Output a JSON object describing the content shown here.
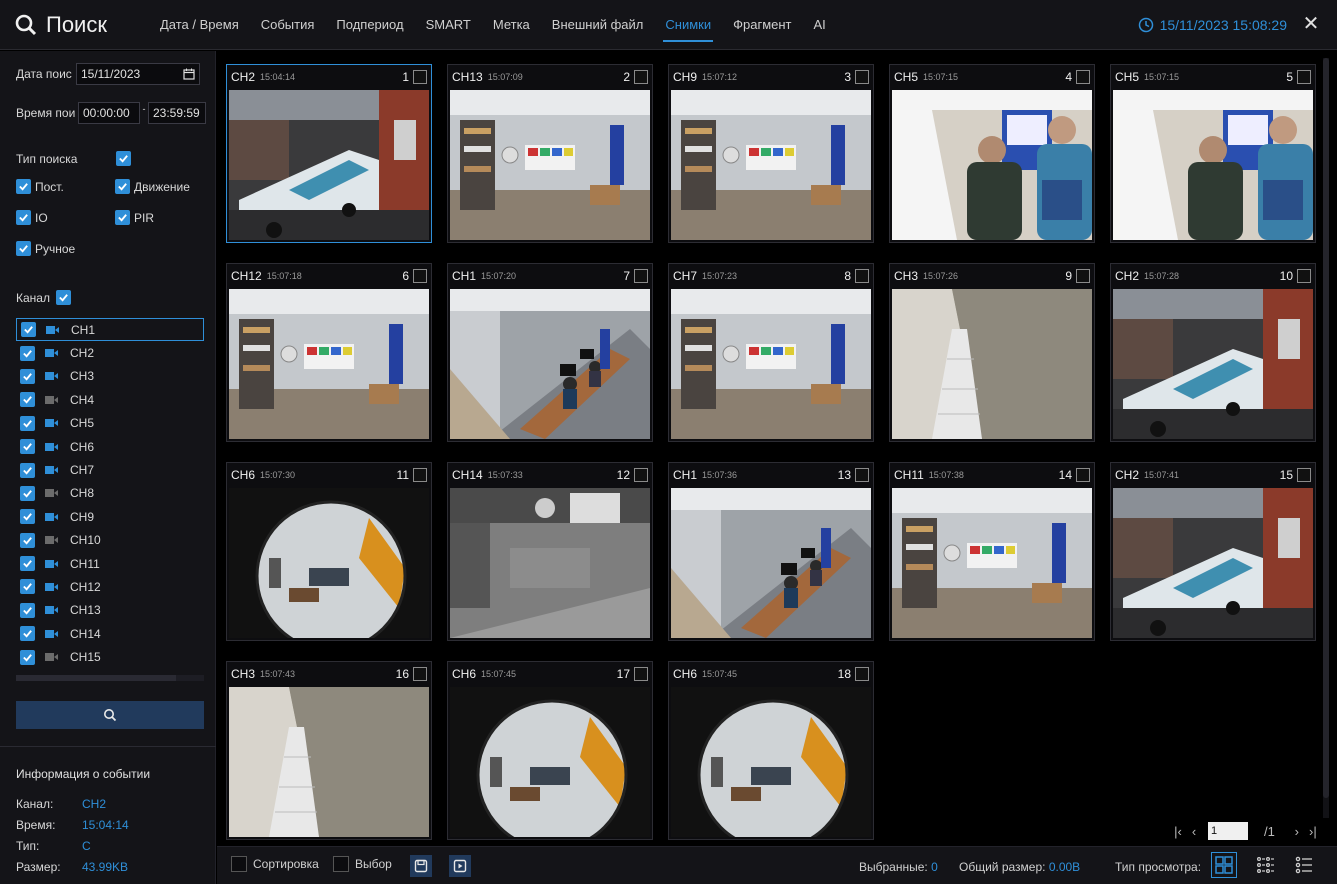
{
  "header": {
    "title": "Поиск",
    "tabs": [
      "Дата / Время",
      "События",
      "Подпериод",
      "SMART",
      "Метка",
      "Внешний файл",
      "Снимки",
      "Фрагмент",
      "AI"
    ],
    "active_tab": "Снимки",
    "datetime": "15/11/2023 15:08:29"
  },
  "filters": {
    "date_label": "Дата поис",
    "date_value": "15/11/2023",
    "time_label": "Время пои",
    "time_start": "00:00:00",
    "time_separator": "-",
    "time_end": "23:59:59",
    "search_type_label": "Тип поиска",
    "types": [
      {
        "label": "Пост.",
        "checked": true
      },
      {
        "label": "Движение",
        "checked": true
      },
      {
        "label": "IO",
        "checked": true
      },
      {
        "label": "PIR",
        "checked": true
      },
      {
        "label": "Ручное",
        "checked": true
      }
    ],
    "channel_label": "Канал"
  },
  "channels": [
    {
      "label": "CH1",
      "checked": true,
      "cam_active": true
    },
    {
      "label": "CH2",
      "checked": true,
      "cam_active": true
    },
    {
      "label": "CH3",
      "checked": true,
      "cam_active": true
    },
    {
      "label": "CH4",
      "checked": true,
      "cam_active": false
    },
    {
      "label": "CH5",
      "checked": true,
      "cam_active": true
    },
    {
      "label": "CH6",
      "checked": true,
      "cam_active": true
    },
    {
      "label": "CH7",
      "checked": true,
      "cam_active": true
    },
    {
      "label": "CH8",
      "checked": true,
      "cam_active": false
    },
    {
      "label": "CH9",
      "checked": true,
      "cam_active": true
    },
    {
      "label": "CH10",
      "checked": true,
      "cam_active": false
    },
    {
      "label": "CH11",
      "checked": true,
      "cam_active": true
    },
    {
      "label": "CH12",
      "checked": true,
      "cam_active": true
    },
    {
      "label": "CH13",
      "checked": true,
      "cam_active": true
    },
    {
      "label": "CH14",
      "checked": true,
      "cam_active": true
    },
    {
      "label": "CH15",
      "checked": true,
      "cam_active": false
    }
  ],
  "event_info": {
    "title": "Информация о событии",
    "rows": [
      {
        "key": "Канал:",
        "value": "CH2"
      },
      {
        "key": "Время:",
        "value": "15:04:14"
      },
      {
        "key": "Тип:",
        "value": "C"
      },
      {
        "key": "Размер:",
        "value": "43.99KB"
      }
    ]
  },
  "snapshots": [
    {
      "ch": "CH2",
      "time": "15:04:14",
      "num": "1",
      "scene": "van"
    },
    {
      "ch": "CH13",
      "time": "15:07:09",
      "num": "2",
      "scene": "office"
    },
    {
      "ch": "CH9",
      "time": "15:07:12",
      "num": "3",
      "scene": "office"
    },
    {
      "ch": "CH5",
      "time": "15:07:15",
      "num": "4",
      "scene": "people"
    },
    {
      "ch": "CH5",
      "time": "15:07:15",
      "num": "5",
      "scene": "people"
    },
    {
      "ch": "CH12",
      "time": "15:07:18",
      "num": "6",
      "scene": "office"
    },
    {
      "ch": "CH1",
      "time": "15:07:20",
      "num": "7",
      "scene": "desks"
    },
    {
      "ch": "CH7",
      "time": "15:07:23",
      "num": "8",
      "scene": "office"
    },
    {
      "ch": "CH3",
      "time": "15:07:26",
      "num": "9",
      "scene": "corridor"
    },
    {
      "ch": "CH2",
      "time": "15:07:28",
      "num": "10",
      "scene": "van"
    },
    {
      "ch": "CH6",
      "time": "15:07:30",
      "num": "11",
      "scene": "fisheye"
    },
    {
      "ch": "CH14",
      "time": "15:07:33",
      "num": "12",
      "scene": "mono"
    },
    {
      "ch": "CH1",
      "time": "15:07:36",
      "num": "13",
      "scene": "desks"
    },
    {
      "ch": "CH11",
      "time": "15:07:38",
      "num": "14",
      "scene": "office"
    },
    {
      "ch": "CH2",
      "time": "15:07:41",
      "num": "15",
      "scene": "van"
    },
    {
      "ch": "CH3",
      "time": "15:07:43",
      "num": "16",
      "scene": "corridor"
    },
    {
      "ch": "CH6",
      "time": "15:07:45",
      "num": "17",
      "scene": "fisheye"
    },
    {
      "ch": "CH6",
      "time": "15:07:45",
      "num": "18",
      "scene": "fisheye"
    }
  ],
  "pager": {
    "current": "1",
    "total": "/1"
  },
  "bottom": {
    "sort_label": "Сортировка",
    "select_label": "Выбор",
    "selected_label": "Выбранные:",
    "selected_value": "0",
    "total_size_label": "Общий размер:",
    "total_size_value": "0.00B",
    "view_type_label": "Тип просмотра:"
  },
  "colors": {
    "accent": "#2f8fd8",
    "panel_bg": "#141418",
    "button_bg": "#213a5c"
  },
  "icons": {
    "title": "search-icon",
    "clock": "clock-icon",
    "close": "close-icon",
    "calendar": "calendar-icon",
    "camera": "camera-icon",
    "search_button": "search-icon",
    "save": "save-icon",
    "play": "play-icon",
    "view_grid": "grid-view-icon",
    "view_list_small": "small-list-view-icon",
    "view_list": "list-view-icon"
  }
}
